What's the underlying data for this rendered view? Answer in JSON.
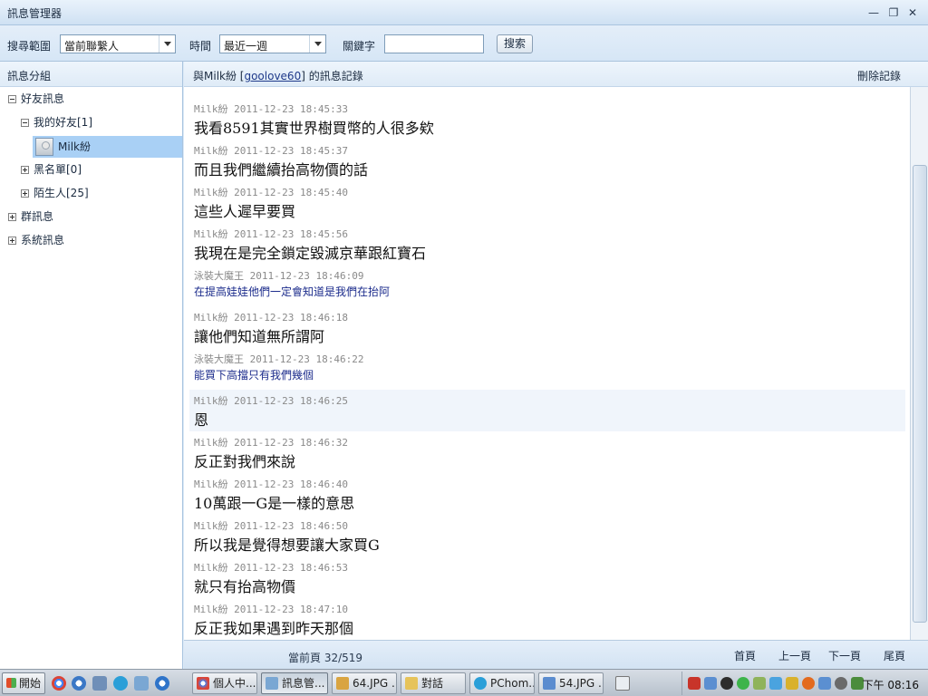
{
  "window": {
    "title": "訊息管理器",
    "minimize": "—",
    "restore": "❐",
    "close": "✕"
  },
  "toolbar": {
    "scope_label": "搜尋範圍",
    "scope_value": "當前聯繫人",
    "time_label": "時間",
    "time_value": "最近一週",
    "keyword_label": "關鍵字",
    "keyword_value": "",
    "search_label": "搜索"
  },
  "sidebar": {
    "header": "訊息分組",
    "friends_group": "好友訊息",
    "my_friends": "我的好友[1]",
    "contact": "Milk紛",
    "blacklist": "黑名單[0]",
    "strangers": "陌生人[25]",
    "group_messages": "群訊息",
    "system_messages": "系統訊息"
  },
  "main": {
    "title_prefix": "與Milk紛 [",
    "contact_id": "goolove60",
    "title_suffix": "] 的訊息記錄",
    "delete_label": "刪除記錄"
  },
  "messages": [
    {
      "sender": "Milk紛",
      "time": "2011-12-23 18:45:33",
      "text": "我看8591其實世界樹買幣的人很多欸"
    },
    {
      "sender": "Milk紛",
      "time": "2011-12-23 18:45:37",
      "text": "而且我們繼續抬高物價的話"
    },
    {
      "sender": "Milk紛",
      "time": "2011-12-23 18:45:40",
      "text": "這些人遲早要買"
    },
    {
      "sender": "Milk紛",
      "time": "2011-12-23 18:45:56",
      "text": "我現在是完全鎖定毀滅京華跟紅寶石"
    },
    {
      "sender": "泳裝大魔王",
      "time": "2011-12-23 18:46:09",
      "text": "在提高娃娃他們一定會知道是我們在抬阿"
    },
    {
      "sender": "Milk紛",
      "time": "2011-12-23 18:46:18",
      "text": "讓他們知道無所謂阿"
    },
    {
      "sender": "泳裝大魔王",
      "time": "2011-12-23 18:46:22",
      "text": "能買下高擋只有我們幾個"
    },
    {
      "sender": "Milk紛",
      "time": "2011-12-23 18:46:25",
      "text": "恩"
    },
    {
      "sender": "Milk紛",
      "time": "2011-12-23 18:46:32",
      "text": "反正對我們來說"
    },
    {
      "sender": "Milk紛",
      "time": "2011-12-23 18:46:40",
      "text": "10萬跟一G是一樣的意思"
    },
    {
      "sender": "Milk紛",
      "time": "2011-12-23 18:46:50",
      "text": "所以我是覺得想要讓大家買G"
    },
    {
      "sender": "Milk紛",
      "time": "2011-12-23 18:46:53",
      "text": "就只有抬高物價"
    },
    {
      "sender": "Milk紛",
      "time": "2011-12-23 18:47:10",
      "text": "反正我如果遇到昨天那個"
    }
  ],
  "pager": {
    "current": "當前頁 32/519",
    "first": "首頁",
    "prev": "上一頁",
    "next": "下一頁",
    "last": "尾頁"
  },
  "taskbar": {
    "start": "開始",
    "tasks": [
      "個人中...",
      "訊息管...",
      "64.JPG ...",
      "對話",
      "PChom...",
      "54.JPG ..."
    ],
    "clock": "下午 08:16"
  }
}
